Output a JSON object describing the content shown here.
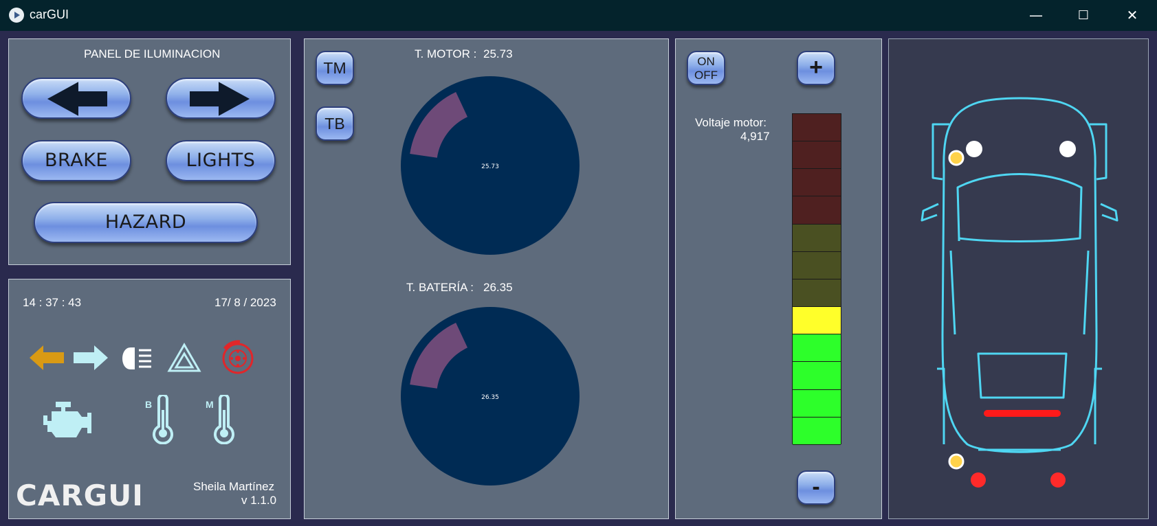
{
  "window": {
    "title": "carGUI",
    "controls": {
      "minimize": "—",
      "maximize": "☐",
      "close": "✕"
    }
  },
  "lighting_panel": {
    "title": "PANEL DE ILUMINACION",
    "buttons": {
      "left_icon": "arrow-left-icon",
      "right_icon": "arrow-right-icon",
      "brake": "BRAKE",
      "lights": "LIGHTS",
      "hazard": "HAZARD"
    }
  },
  "status_panel": {
    "time": "14 : 37 : 43",
    "date": "17/ 8 / 2023",
    "indicators": [
      {
        "icon": "turn-left-icon",
        "color": "#d99a14"
      },
      {
        "icon": "turn-right-icon",
        "color": "#bfeff5"
      },
      {
        "icon": "headlight-icon",
        "color": "#ffffff"
      },
      {
        "icon": "hazard-icon",
        "color": "#bfeff5"
      },
      {
        "icon": "brake-disc-icon",
        "color": "#e0262a"
      },
      {
        "icon": "engine-icon",
        "color": "#bfeff5"
      },
      {
        "icon": "battery-temp-icon",
        "label": "B",
        "color": "#bfeff5"
      },
      {
        "icon": "motor-temp-icon",
        "label": "M",
        "color": "#bfeff5"
      }
    ],
    "logo": "CARGUI",
    "author": "Sheila Martínez",
    "version": "v 1.1.0"
  },
  "temperature_panel": {
    "tm_button": "TM",
    "tb_button": "TB",
    "motor": {
      "label": "T. MOTOR :",
      "value": "25.73",
      "fill_fraction": 0.3
    },
    "battery": {
      "label": "T. BATERÍA :",
      "value": "26.35",
      "fill_fraction": 0.3
    }
  },
  "voltage_panel": {
    "on_label": "ON",
    "off_label": "OFF",
    "plus": "+",
    "minus": "-",
    "label": "Voltaje motor:",
    "value": "4,917",
    "segments_total": 12,
    "segments_lit": 5,
    "colors": {
      "red_dim": "#4f2020",
      "olive_dim": "#4a5022",
      "yellow": "#ffff2a",
      "green": "#2dff2a"
    }
  },
  "car_panel": {
    "icon": "car-topview-icon",
    "outline_color": "#4fd6f2",
    "lights": {
      "front_white": "#ffffff",
      "front_amber": "#ffd24a",
      "rear_red": "#ff2a2a",
      "brake_bar": "#ff1a1a"
    }
  }
}
